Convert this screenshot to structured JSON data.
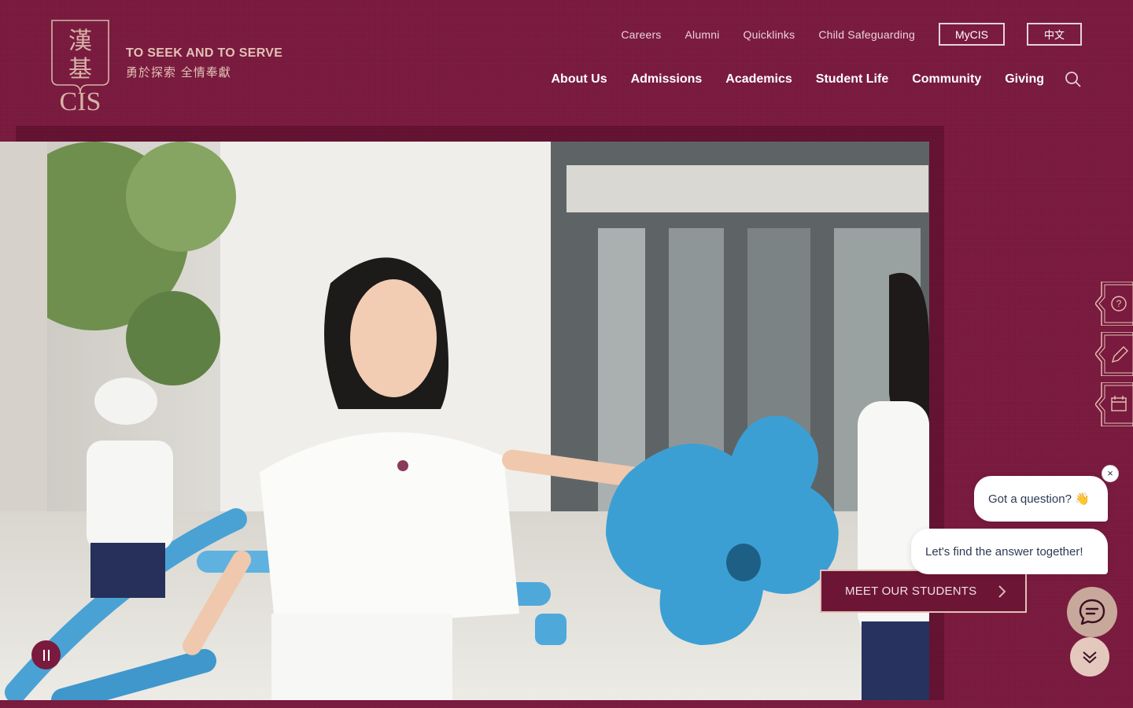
{
  "brand": {
    "logo_text": "CIS",
    "logo_chinese": "漢基",
    "tagline_en": "TO SEEK AND TO SERVE",
    "tagline_zh": "勇於探索  全情奉獻"
  },
  "utility_nav": {
    "links": [
      "Careers",
      "Alumni",
      "Quicklinks",
      "Child Safeguarding"
    ],
    "mycis_label": "MyCIS",
    "language_label": "中文"
  },
  "main_nav": {
    "items": [
      "About Us",
      "Admissions",
      "Academics",
      "Student Life",
      "Community",
      "Giving"
    ],
    "search_icon": "search-icon"
  },
  "hero": {
    "image": "video frame of schoolchildren playing with blue foam blocks",
    "cta_label": "MEET OUR STUDENTS",
    "pause_icon": "pause-icon"
  },
  "side_tabs": [
    "question-icon",
    "pencil-icon",
    "calendar-icon"
  ],
  "chat": {
    "bubble1": "Got a question? 👋",
    "bubble2": "Let's find the answer together!",
    "close_label": "×"
  },
  "colors": {
    "brand_maroon": "#7a1a3e",
    "gold_accent": "#e3c1b6",
    "chat_button": "#c9a89c"
  }
}
